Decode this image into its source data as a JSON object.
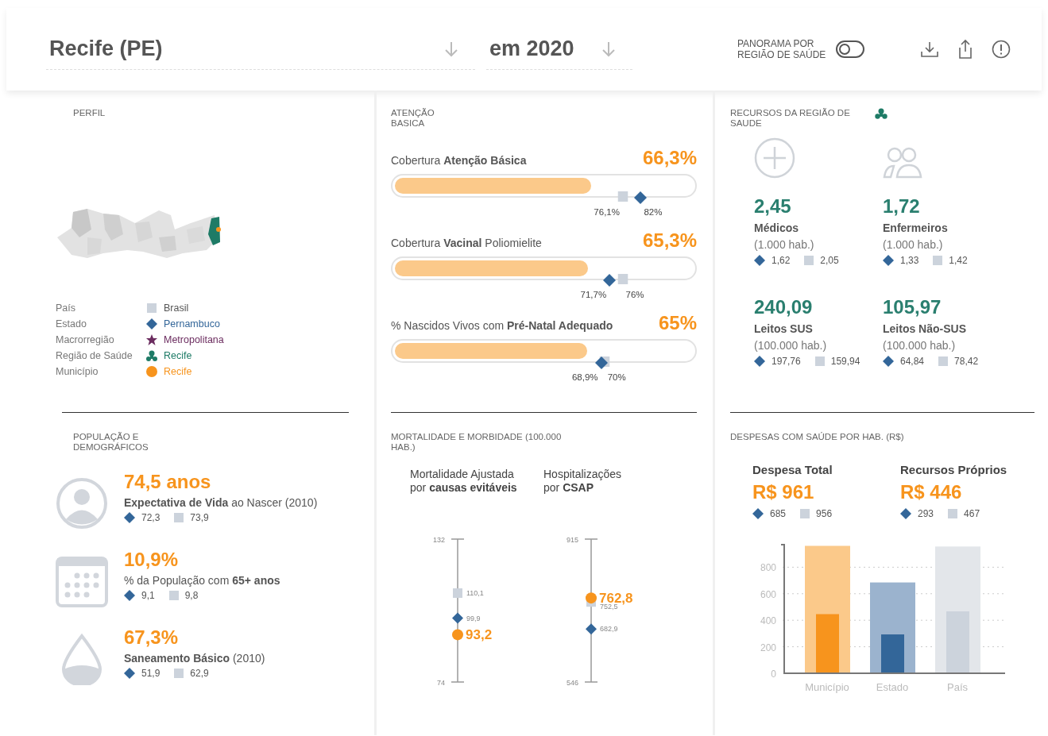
{
  "header": {
    "place": "Recife (PE)",
    "year": "em 2020",
    "toggle": {
      "label": "PANORAMA POR REGIÃO DE SAÚDE",
      "on": false
    }
  },
  "perfil": {
    "title": "PERFIL",
    "legend": [
      {
        "label": "País",
        "value": "Brasil",
        "kind": "square",
        "color": "#ccd3dc"
      },
      {
        "label": "Estado",
        "value": "Pernambuco",
        "kind": "diamond",
        "color": "#336699"
      },
      {
        "label": "Macrorregião",
        "value": "Metropolitana",
        "kind": "star",
        "color": "#6b2c5f"
      },
      {
        "label": "Região de Saúde",
        "value": "Recife",
        "kind": "trefoil",
        "color": "#1e7b66"
      },
      {
        "label": "Município",
        "value": "Recife",
        "kind": "circle",
        "color": "#f7941d"
      }
    ]
  },
  "atencao": {
    "title": "ATENÇÃO BASICA",
    "metrics": [
      {
        "label": "Cobertura **Atenção Básica**",
        "value": "66,3%",
        "level": 0.663,
        "state": {
          "level": 0.82,
          "reading": "82%"
        },
        "country": {
          "level": 0.761,
          "reading": "76,1%"
        }
      },
      {
        "label": "Cobertura **Vacinal** Poliomielite",
        "value": "65,3%",
        "level": 0.653,
        "state": {
          "level": 0.717,
          "reading": "71,7%"
        },
        "country": {
          "level": 0.76,
          "reading": "76%"
        }
      },
      {
        "label": "% Nascidos Vivos com **Pré-Natal Adequado**",
        "value": "65%",
        "level": 0.65,
        "state": {
          "level": 0.689,
          "reading": "68,9%"
        },
        "country": {
          "level": 0.7,
          "reading": "70%"
        }
      }
    ]
  },
  "recursos": {
    "title": "RECURSOS DA REGIÃO DE SAUDE",
    "items": [
      {
        "kind": "plus",
        "value": "2,45",
        "label": "Médicos",
        "unit": "(1.000 hab.)",
        "state": "1,62",
        "country": "2,05"
      },
      {
        "kind": "people",
        "value": "1,72",
        "label": "Enfermeiros",
        "unit": "(1.000 hab.)",
        "state": "1,33",
        "country": "1,42"
      },
      {
        "kind": "number",
        "value": "240,09",
        "label": "Leitos SUS",
        "unit": "(100.000 hab.)",
        "state": "197,76",
        "country": "159,94"
      },
      {
        "kind": "number",
        "value": "105,97",
        "label": "Leitos Não-SUS",
        "unit": "(100.000 hab.)",
        "state": "64,84",
        "country": "78,42"
      }
    ]
  },
  "populacao": {
    "title": "POPULAÇÃO E DEMOGRÁFICOS",
    "items": [
      {
        "kind": "person",
        "value": "74,5 anos",
        "label": "**Expectativa de Vida** ao Nascer (2010)",
        "state": "72,3",
        "country": "73,9"
      },
      {
        "kind": "calendar",
        "value": "10,9%",
        "label": "% da População com **65+ anos**",
        "state": "9,1",
        "country": "9,8"
      },
      {
        "kind": "drop",
        "value": "67,3%",
        "label": "**Saneamento Básico** (2010)",
        "state": "51,9",
        "country": "62,9"
      }
    ]
  },
  "mortalidade": {
    "title": "MORTALIDADE E MORBIDADE (100.000 HAB.)",
    "charts": [
      {
        "heading": "Mortalidade Ajustada por **causas evitáveis**",
        "ticks": [
          "132",
          "74"
        ],
        "points": [
          {
            "kind": "square",
            "level": 0.622,
            "reading": "110,1"
          },
          {
            "kind": "diamond",
            "level": 0.447,
            "reading": "99,9"
          },
          {
            "kind": "circle",
            "level": 0.331,
            "reading": "93,2"
          }
        ]
      },
      {
        "heading": "Hospitalizações por **CSAP**",
        "ticks": [
          "915",
          "546"
        ],
        "points": [
          {
            "kind": "circle",
            "level": 0.588,
            "reading": "762,8"
          },
          {
            "kind": "square",
            "level": 0.56,
            "reading": "752,5"
          },
          {
            "kind": "diamond",
            "level": 0.371,
            "reading": "682,9"
          }
        ]
      }
    ]
  },
  "despesas": {
    "title": "DESPESAS COM SAÚDE POR HAB. (R$)",
    "totals": [
      {
        "label": "Despesa Total",
        "value": "R$ 961",
        "state": "685",
        "country": "956"
      },
      {
        "label": "Recursos Próprios",
        "value": "R$ 446",
        "state": "293",
        "country": "467"
      }
    ],
    "chart_data": {
      "type": "bar",
      "categories": [
        "Município",
        "Estado",
        "País"
      ],
      "ylim": [
        0,
        970
      ],
      "yticks": [
        0,
        200,
        400,
        600,
        800
      ],
      "grid": true,
      "series": [
        {
          "colors": [
            "#fbc98a",
            "#9bb3ce",
            "#e3e6ea"
          ],
          "values": [
            961,
            685,
            956
          ]
        },
        {
          "colors": [
            "#f7941d",
            "#336699",
            "#ccd3dc"
          ],
          "values": [
            446,
            293,
            467
          ]
        }
      ]
    }
  }
}
